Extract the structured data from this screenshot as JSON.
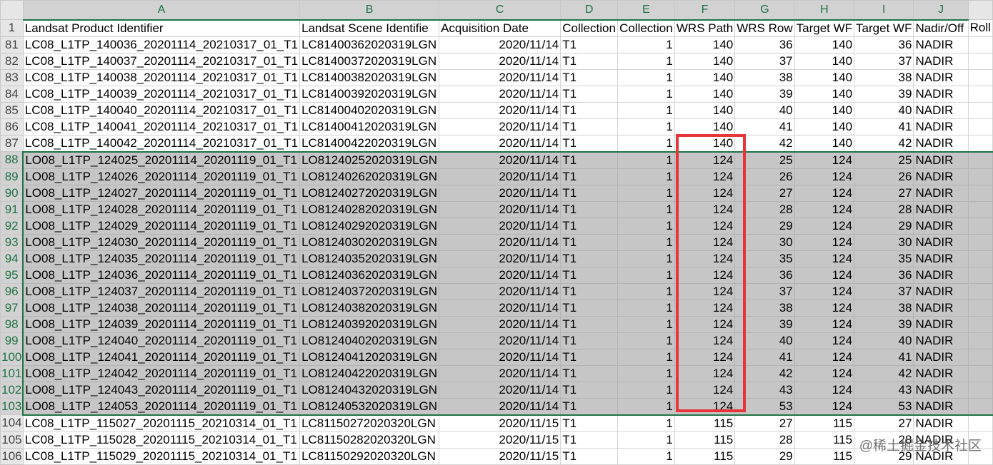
{
  "columns": [
    "A",
    "B",
    "C",
    "D",
    "E",
    "F",
    "G",
    "H",
    "I",
    "J",
    ""
  ],
  "header_row": {
    "num": "1",
    "cells": [
      "Landsat Product Identifier",
      "Landsat Scene Identifie",
      "Acquisition Date",
      "Collection",
      "Collection",
      "WRS Path",
      "WRS Row",
      "Target WF",
      "Target WF",
      "Nadir/Off",
      "Roll"
    ]
  },
  "rows": [
    {
      "num": "81",
      "sel": false,
      "cells": [
        "LC08_L1TP_140036_20201114_20210317_01_T1",
        "LC81400362020319LGN",
        "2020/11/14",
        "T1",
        "1",
        "140",
        "36",
        "140",
        "36",
        "NADIR",
        ""
      ]
    },
    {
      "num": "82",
      "sel": false,
      "cells": [
        "LC08_L1TP_140037_20201114_20210317_01_T1",
        "LC81400372020319LGN",
        "2020/11/14",
        "T1",
        "1",
        "140",
        "37",
        "140",
        "37",
        "NADIR",
        ""
      ]
    },
    {
      "num": "83",
      "sel": false,
      "cells": [
        "LC08_L1TP_140038_20201114_20210317_01_T1",
        "LC81400382020319LGN",
        "2020/11/14",
        "T1",
        "1",
        "140",
        "38",
        "140",
        "38",
        "NADIR",
        ""
      ]
    },
    {
      "num": "84",
      "sel": false,
      "cells": [
        "LC08_L1TP_140039_20201114_20210317_01_T1",
        "LC81400392020319LGN",
        "2020/11/14",
        "T1",
        "1",
        "140",
        "39",
        "140",
        "39",
        "NADIR",
        ""
      ]
    },
    {
      "num": "85",
      "sel": false,
      "cells": [
        "LC08_L1TP_140040_20201114_20210317_01_T1",
        "LC81400402020319LGN",
        "2020/11/14",
        "T1",
        "1",
        "140",
        "40",
        "140",
        "40",
        "NADIR",
        ""
      ]
    },
    {
      "num": "86",
      "sel": false,
      "cells": [
        "LC08_L1TP_140041_20201114_20210317_01_T1",
        "LC81400412020319LGN",
        "2020/11/14",
        "T1",
        "1",
        "140",
        "41",
        "140",
        "41",
        "NADIR",
        ""
      ]
    },
    {
      "num": "87",
      "sel": false,
      "cells": [
        "LC08_L1TP_140042_20201114_20210317_01_T1",
        "LC81400422020319LGN",
        "2020/11/14",
        "T1",
        "1",
        "140",
        "42",
        "140",
        "42",
        "NADIR",
        ""
      ]
    },
    {
      "num": "88",
      "sel": true,
      "cells": [
        "LO08_L1TP_124025_20201114_20201119_01_T1",
        "LO81240252020319LGN",
        "2020/11/14",
        "T1",
        "1",
        "124",
        "25",
        "124",
        "25",
        "NADIR",
        ""
      ]
    },
    {
      "num": "89",
      "sel": true,
      "cells": [
        "LO08_L1TP_124026_20201114_20201119_01_T1",
        "LO81240262020319LGN",
        "2020/11/14",
        "T1",
        "1",
        "124",
        "26",
        "124",
        "26",
        "NADIR",
        ""
      ]
    },
    {
      "num": "90",
      "sel": true,
      "cells": [
        "LO08_L1TP_124027_20201114_20201119_01_T1",
        "LO81240272020319LGN",
        "2020/11/14",
        "T1",
        "1",
        "124",
        "27",
        "124",
        "27",
        "NADIR",
        ""
      ]
    },
    {
      "num": "91",
      "sel": true,
      "cells": [
        "LO08_L1TP_124028_20201114_20201119_01_T1",
        "LO81240282020319LGN",
        "2020/11/14",
        "T1",
        "1",
        "124",
        "28",
        "124",
        "28",
        "NADIR",
        ""
      ]
    },
    {
      "num": "92",
      "sel": true,
      "cells": [
        "LO08_L1TP_124029_20201114_20201119_01_T1",
        "LO81240292020319LGN",
        "2020/11/14",
        "T1",
        "1",
        "124",
        "29",
        "124",
        "29",
        "NADIR",
        ""
      ]
    },
    {
      "num": "93",
      "sel": true,
      "cells": [
        "LO08_L1TP_124030_20201114_20201119_01_T1",
        "LO81240302020319LGN",
        "2020/11/14",
        "T1",
        "1",
        "124",
        "30",
        "124",
        "30",
        "NADIR",
        ""
      ]
    },
    {
      "num": "94",
      "sel": true,
      "cells": [
        "LO08_L1TP_124035_20201114_20201119_01_T1",
        "LO81240352020319LGN",
        "2020/11/14",
        "T1",
        "1",
        "124",
        "35",
        "124",
        "35",
        "NADIR",
        ""
      ]
    },
    {
      "num": "95",
      "sel": true,
      "cells": [
        "LO08_L1TP_124036_20201114_20201119_01_T1",
        "LO81240362020319LGN",
        "2020/11/14",
        "T1",
        "1",
        "124",
        "36",
        "124",
        "36",
        "NADIR",
        ""
      ]
    },
    {
      "num": "96",
      "sel": true,
      "cells": [
        "LO08_L1TP_124037_20201114_20201119_01_T1",
        "LO81240372020319LGN",
        "2020/11/14",
        "T1",
        "1",
        "124",
        "37",
        "124",
        "37",
        "NADIR",
        ""
      ]
    },
    {
      "num": "97",
      "sel": true,
      "cells": [
        "LO08_L1TP_124038_20201114_20201119_01_T1",
        "LO81240382020319LGN",
        "2020/11/14",
        "T1",
        "1",
        "124",
        "38",
        "124",
        "38",
        "NADIR",
        ""
      ]
    },
    {
      "num": "98",
      "sel": true,
      "cells": [
        "LO08_L1TP_124039_20201114_20201119_01_T1",
        "LO81240392020319LGN",
        "2020/11/14",
        "T1",
        "1",
        "124",
        "39",
        "124",
        "39",
        "NADIR",
        ""
      ]
    },
    {
      "num": "99",
      "sel": true,
      "cells": [
        "LO08_L1TP_124040_20201114_20201119_01_T1",
        "LO81240402020319LGN",
        "2020/11/14",
        "T1",
        "1",
        "124",
        "40",
        "124",
        "40",
        "NADIR",
        ""
      ]
    },
    {
      "num": "100",
      "sel": true,
      "cells": [
        "LO08_L1TP_124041_20201114_20201119_01_T1",
        "LO81240412020319LGN",
        "2020/11/14",
        "T1",
        "1",
        "124",
        "41",
        "124",
        "41",
        "NADIR",
        ""
      ]
    },
    {
      "num": "101",
      "sel": true,
      "cells": [
        "LO08_L1TP_124042_20201114_20201119_01_T1",
        "LO81240422020319LGN",
        "2020/11/14",
        "T1",
        "1",
        "124",
        "42",
        "124",
        "42",
        "NADIR",
        ""
      ]
    },
    {
      "num": "102",
      "sel": true,
      "cells": [
        "LO08_L1TP_124043_20201114_20201119_01_T1",
        "LO81240432020319LGN",
        "2020/11/14",
        "T1",
        "1",
        "124",
        "43",
        "124",
        "43",
        "NADIR",
        ""
      ]
    },
    {
      "num": "103",
      "sel": true,
      "cells": [
        "LO08_L1TP_124053_20201114_20201119_01_T1",
        "LO81240532020319LGN",
        "2020/11/14",
        "T1",
        "1",
        "124",
        "53",
        "124",
        "53",
        "NADIR",
        ""
      ]
    },
    {
      "num": "104",
      "sel": false,
      "cells": [
        "LC08_L1TP_115027_20201115_20210314_01_T1",
        "LC81150272020320LGN",
        "2020/11/15",
        "T1",
        "1",
        "115",
        "27",
        "115",
        "27",
        "NADIR",
        ""
      ]
    },
    {
      "num": "105",
      "sel": false,
      "cells": [
        "LC08_L1TP_115028_20201115_20210314_01_T1",
        "LC81150282020320LGN",
        "2020/11/15",
        "T1",
        "1",
        "115",
        "28",
        "115",
        "28",
        "NADIR",
        ""
      ]
    },
    {
      "num": "106",
      "sel": false,
      "cells": [
        "LC08_L1TP_115029_20201115_20210314_01_T1",
        "LC81150292020320LGN",
        "2020/11/15",
        "T1",
        "1",
        "115",
        "29",
        "115",
        "29",
        "NADIR",
        ""
      ]
    }
  ],
  "numeric_columns": [
    2,
    4,
    5,
    6,
    7,
    8
  ],
  "watermark": "@稀土掘金技术社区",
  "colors": {
    "selection_fill": "#c6c6c6",
    "selection_border": "#217346",
    "highlight_box": "#e8353a"
  }
}
